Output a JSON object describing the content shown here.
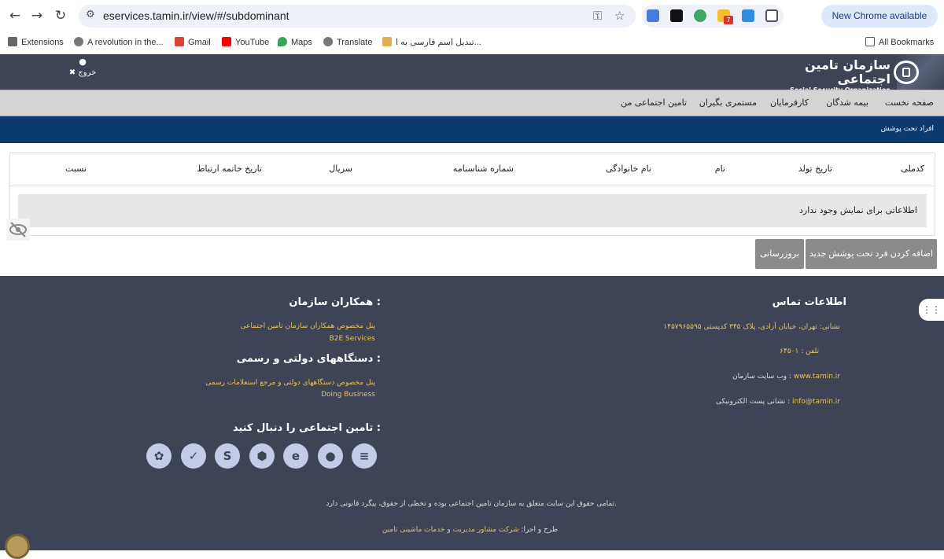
{
  "browser": {
    "url": "eservices.tamin.ir/view/#/subdominant",
    "new_chrome": "New Chrome available",
    "bookmarks": {
      "extensions": "Extensions",
      "revolution": "A revolution in the...",
      "gmail": "Gmail",
      "youtube": "YouTube",
      "maps": "Maps",
      "translate": "Translate",
      "persian": "تبدیل اسم فارسی به ا...",
      "all": "All Bookmarks"
    },
    "ext_badge": "7"
  },
  "header": {
    "logo_fa": "سازمان تامین اجتماعی",
    "logo_en": "Social Security Organization",
    "logout": "✖ خروج"
  },
  "menu": [
    "صفحه نخست",
    "بیمه شدگان",
    "کارفرمایان",
    "مستمری بگیران",
    "تامین اجتماعی من"
  ],
  "section_title": "افراد تحت پوشش",
  "table": {
    "headers": [
      "کدملی",
      "تاریخ تولد",
      "نام",
      "نام خانوادگی",
      "شماره شناسنامه",
      "سریال",
      "تاریخ خاتمه ارتباط",
      "نسبت"
    ],
    "empty": "اطلاعاتی برای نمایش وجود ندارد"
  },
  "buttons": {
    "add": "اضافه کردن فرد تحت پوشش جدید",
    "refresh": "بروزرسانی"
  },
  "footer": {
    "contact_title": "اطلاعات تماس",
    "address": "نشانی: تهران، خیابان آزادی، پلاک ۳۴۵ کدپستی ۱۴۵۷۹۶۵۵۹۵",
    "phone": "تلفن : ۶۴۵۰۱",
    "website_label": "وب سایت سازمان : ",
    "website": "www.tamin.ir",
    "email_label": "نشانی پست الکترونیکی : ",
    "email": "info@tamin.ir",
    "partners_title": "همکاران سازمان :",
    "partners_link": "پنل مخصوص همکاران سازمان تامین اجتماعی",
    "partners_en": "B2E Services",
    "gov_title": "دستگاههای دولتی و رسمی :",
    "gov_link": "پنل مخصوص دستگاههای دولتی و مرجع استعلامات رسمی",
    "gov_en": "Doing Business",
    "follow_title": "تامین اجتماعی را دنبال کنید :",
    "copyright": "تمامی حقوق این سایت متعلق به سازمان تامین اجتماعی بوده و تخطی از حقوق، پیگرد قانونی دارد.",
    "design_label": "طرح و اجرا: ",
    "design_company": "شرکت مشاور مدیریت و خدمات ماشینی تامین"
  },
  "social_icons": [
    "aparat-icon",
    "bale-icon",
    "soroush-icon",
    "rubika-icon",
    "eitaa-icon",
    "gap-icon",
    "igap-icon"
  ]
}
